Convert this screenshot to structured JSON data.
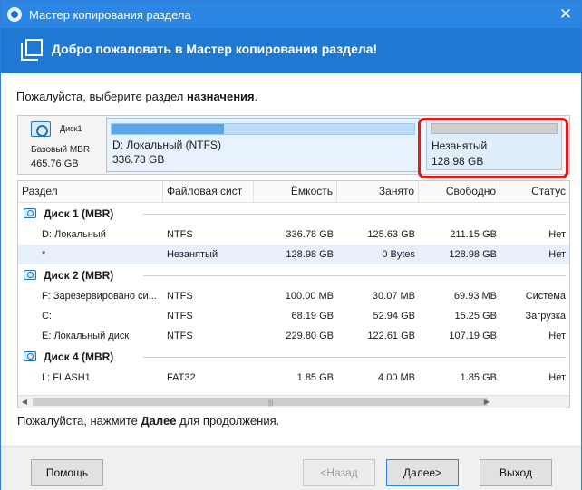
{
  "window": {
    "title": "Мастер копирования раздела",
    "close_glyph": "✕",
    "header_title": "Добро пожаловать в Мастер копирования раздела!"
  },
  "instruction": {
    "prefix": "Пожалуйста, выберите раздел ",
    "bold": "назначения",
    "suffix": "."
  },
  "disk_map": {
    "disk_name": "Диск1",
    "disk_type": "Базовый MBR",
    "disk_size": "465.76 GB",
    "partitions": [
      {
        "name": "D: Локальный (NTFS)",
        "size": "336.78 GB",
        "used_fraction": 0.37
      },
      {
        "name": "Незанятый",
        "size": "128.98 GB",
        "highlighted": true
      }
    ]
  },
  "table": {
    "columns": [
      "Раздел",
      "Файловая сист",
      "Ёмкость",
      "Занято",
      "Свободно",
      "Статус"
    ],
    "groups": [
      {
        "label": "Диск 1 (MBR)",
        "rows": [
          {
            "partition": "D: Локальный",
            "fs": "NTFS",
            "capacity": "336.78 GB",
            "used": "125.63 GB",
            "free": "211.15 GB",
            "status": "Нет",
            "selected": false
          },
          {
            "partition": "*",
            "fs": "Незанятый",
            "capacity": "128.98 GB",
            "used": "0 Bytes",
            "free": "128.98 GB",
            "status": "Нет",
            "selected": true
          }
        ]
      },
      {
        "label": "Диск 2 (MBR)",
        "rows": [
          {
            "partition": "F: Зарезервировано си...",
            "fs": "NTFS",
            "capacity": "100.00 MB",
            "used": "30.07 MB",
            "free": "69.93 MB",
            "status": "Система",
            "selected": false
          },
          {
            "partition": "C:",
            "fs": "NTFS",
            "capacity": "68.19 GB",
            "used": "52.94 GB",
            "free": "15.25 GB",
            "status": "Загрузка",
            "selected": false
          },
          {
            "partition": "E: Локальный диск",
            "fs": "NTFS",
            "capacity": "229.80 GB",
            "used": "122.61 GB",
            "free": "107.19 GB",
            "status": "Нет",
            "selected": false
          }
        ]
      },
      {
        "label": "Диск 4 (MBR)",
        "rows": [
          {
            "partition": "L: FLASH1",
            "fs": "FAT32",
            "capacity": "1.85 GB",
            "used": "4.00 MB",
            "free": "1.85 GB",
            "status": "Нет",
            "selected": false
          }
        ]
      }
    ]
  },
  "continue_text": {
    "prefix": "Пожалуйста, нажмите ",
    "bold": "Далее",
    "suffix": " для продолжения."
  },
  "buttons": {
    "help": "Помощь",
    "back": "<Назад",
    "next": "Далее>",
    "exit": "Выход"
  },
  "colors": {
    "titlebar": "#2b87e3",
    "header": "#1f78d1",
    "highlight": "#e01b1b",
    "selected_row": "#e7f0fb"
  }
}
